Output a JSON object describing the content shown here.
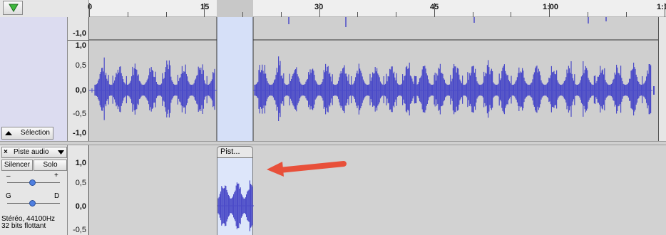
{
  "ruler": {
    "play_icon": "play-triangle-icon",
    "ticks": [
      {
        "label": "0"
      },
      {
        "label": "15"
      },
      {
        "label": "30"
      },
      {
        "label": "45"
      },
      {
        "label": "1:00"
      },
      {
        "label": "1:1"
      }
    ]
  },
  "track1": {
    "vruler_top": "-1,0",
    "scale": [
      "1,0",
      "0,5",
      "0,0",
      "-0,5",
      "-1,0"
    ],
    "selection_button": "Sélection",
    "collapse_icon": "collapse-arrow-icon",
    "wave_color": "#4b4bc8",
    "selection_color": "#d6e0f8"
  },
  "track2": {
    "close_label": "×",
    "name": "Piste audio",
    "menu_icon": "dropdown-triangle-icon",
    "mute_label": "Silencer",
    "solo_label": "Solo",
    "gain_minus": "–",
    "gain_plus": "+",
    "pan_left": "G",
    "pan_right": "D",
    "info_line1": "Stéréo, 44100Hz",
    "info_line2": "32 bits flottant",
    "scale": [
      "1,0",
      "0,5",
      "0,0",
      "-0,5"
    ],
    "clip_name": "Pist..."
  },
  "annotation": {
    "arrow_color": "#e8503a"
  }
}
